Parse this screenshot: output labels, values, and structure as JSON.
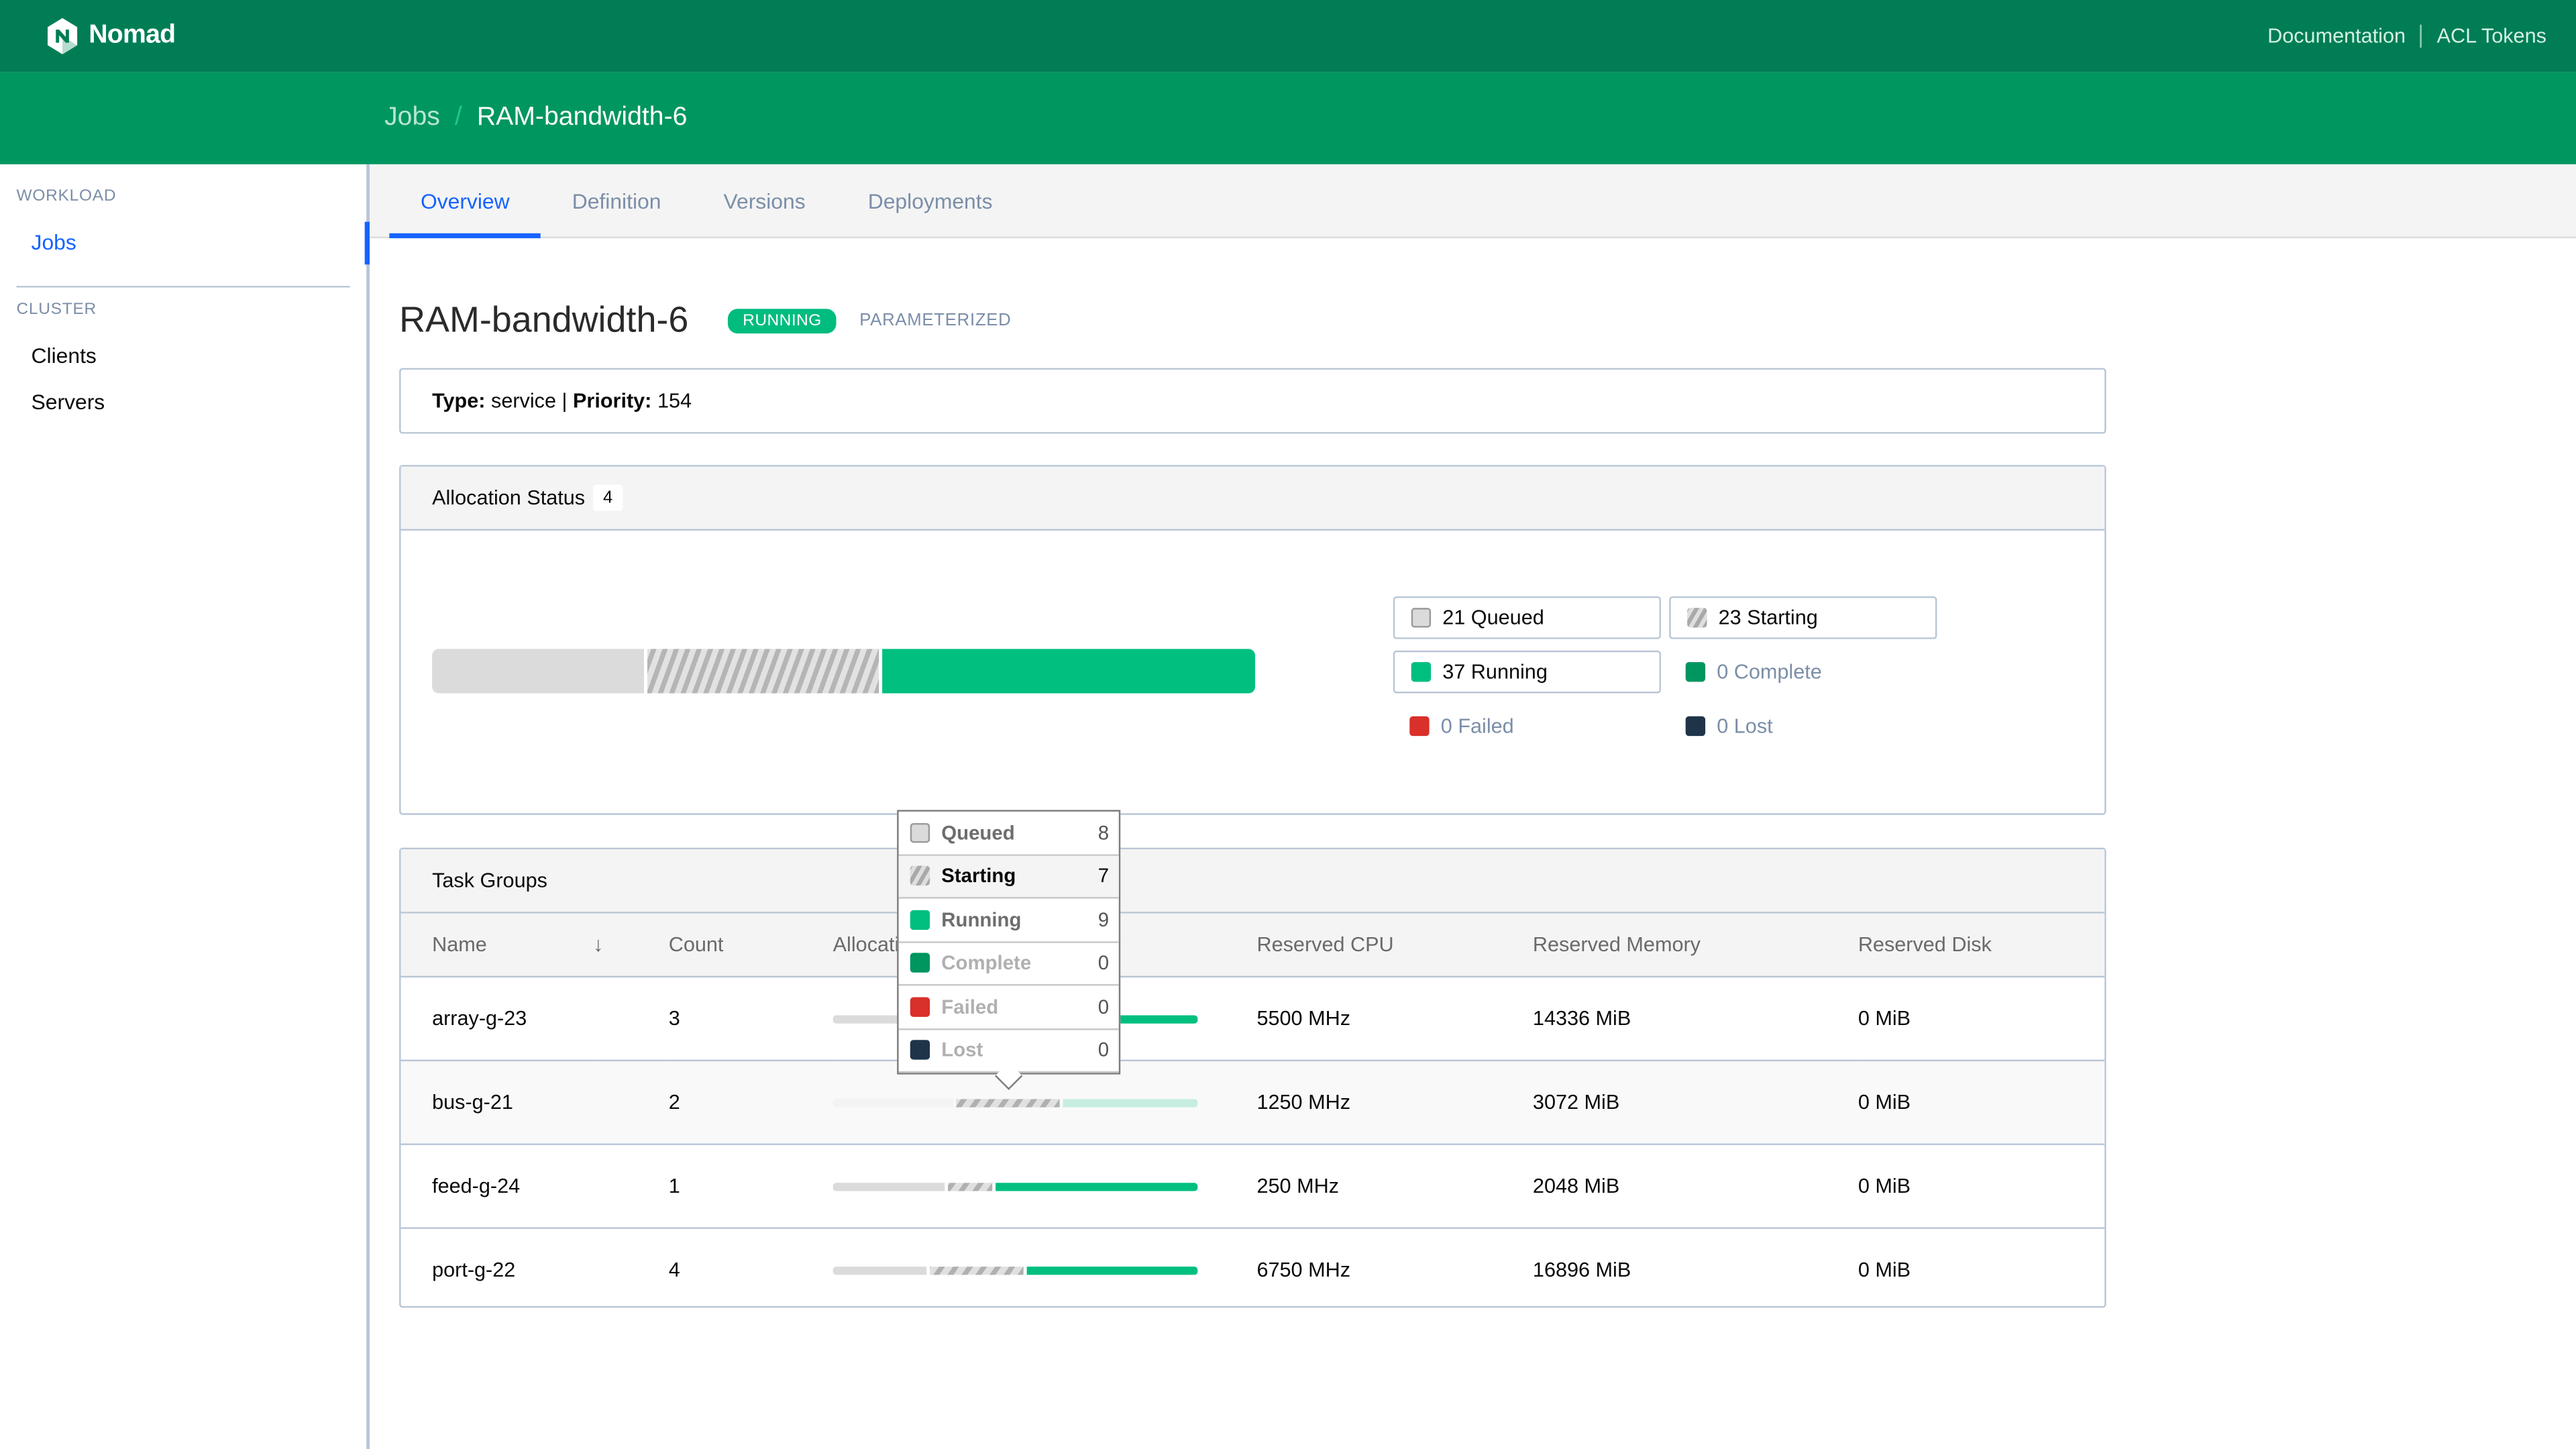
{
  "topnav": {
    "brand": "Nomad",
    "links": [
      "Documentation",
      "ACL Tokens"
    ]
  },
  "breadcrumb": {
    "parent": "Jobs",
    "separator": "/",
    "current": "RAM-bandwidth-6"
  },
  "sidebar": {
    "sections": [
      {
        "label": "WORKLOAD",
        "items": [
          {
            "label": "Jobs",
            "active": true
          }
        ]
      },
      {
        "label": "CLUSTER",
        "items": [
          {
            "label": "Clients",
            "active": false
          },
          {
            "label": "Servers",
            "active": false
          }
        ]
      }
    ]
  },
  "tabs": [
    {
      "label": "Overview",
      "active": true
    },
    {
      "label": "Definition",
      "active": false
    },
    {
      "label": "Versions",
      "active": false
    },
    {
      "label": "Deployments",
      "active": false
    }
  ],
  "job": {
    "name": "RAM-bandwidth-6",
    "status": "RUNNING",
    "tag": "PARAMETERIZED",
    "type_label": "Type:",
    "type": "service",
    "priority_label": "Priority:",
    "priority": "154",
    "meta_sep": "|"
  },
  "colors": {
    "queued": "#dbdbdb",
    "starting": "#b5b5b5",
    "running": "#00bf7f",
    "complete": "#00965f",
    "failed": "#d9302b",
    "lost": "#1f3449",
    "accent": "#1563ff",
    "nav_dark": "#007d55",
    "nav": "#00965f"
  },
  "allocation_status": {
    "title": "Allocation Status",
    "count": "4",
    "bar": {
      "queued": 21,
      "starting": 23,
      "running": 37,
      "complete": 0,
      "failed": 0,
      "lost": 0
    },
    "legend": [
      {
        "key": "queued",
        "count": "21",
        "label": "Queued"
      },
      {
        "key": "starting",
        "count": "23",
        "label": "Starting"
      },
      {
        "key": "running",
        "count": "37",
        "label": "Running"
      },
      {
        "key": "complete",
        "count": "0",
        "label": "Complete"
      },
      {
        "key": "failed",
        "count": "0",
        "label": "Failed"
      },
      {
        "key": "lost",
        "count": "0",
        "label": "Lost"
      }
    ]
  },
  "task_groups": {
    "title": "Task Groups",
    "columns": [
      "Name",
      "Count",
      "Allocation Status",
      "Reserved CPU",
      "Reserved Memory",
      "Reserved Disk"
    ],
    "rows": [
      {
        "name": "array-g-23",
        "count": "3",
        "alloc": {
          "queued": 4,
          "starting": 7,
          "running": 9
        },
        "cpu": "5500 MHz",
        "memory": "14336 MiB",
        "disk": "0 MiB"
      },
      {
        "name": "bus-g-21",
        "count": "2",
        "alloc": {
          "queued": 8,
          "starting": 7,
          "running": 9
        },
        "cpu": "1250 MHz",
        "memory": "3072 MiB",
        "disk": "0 MiB",
        "hover": true
      },
      {
        "name": "feed-g-24",
        "count": "1",
        "alloc": {
          "queued": 5,
          "starting": 2,
          "running": 9
        },
        "cpu": "250 MHz",
        "memory": "2048 MiB",
        "disk": "0 MiB"
      },
      {
        "name": "port-g-22",
        "count": "4",
        "alloc": {
          "queued": 6,
          "starting": 6,
          "running": 11
        },
        "cpu": "6750 MHz",
        "memory": "16896 MiB",
        "disk": "0 MiB"
      }
    ]
  },
  "tooltip": {
    "rows": [
      {
        "key": "queued",
        "label": "Queued",
        "value": "8"
      },
      {
        "key": "starting",
        "label": "Starting",
        "value": "7",
        "active": true
      },
      {
        "key": "running",
        "label": "Running",
        "value": "9"
      },
      {
        "key": "complete",
        "label": "Complete",
        "value": "0"
      },
      {
        "key": "failed",
        "label": "Failed",
        "value": "0"
      },
      {
        "key": "lost",
        "label": "Lost",
        "value": "0"
      }
    ]
  }
}
